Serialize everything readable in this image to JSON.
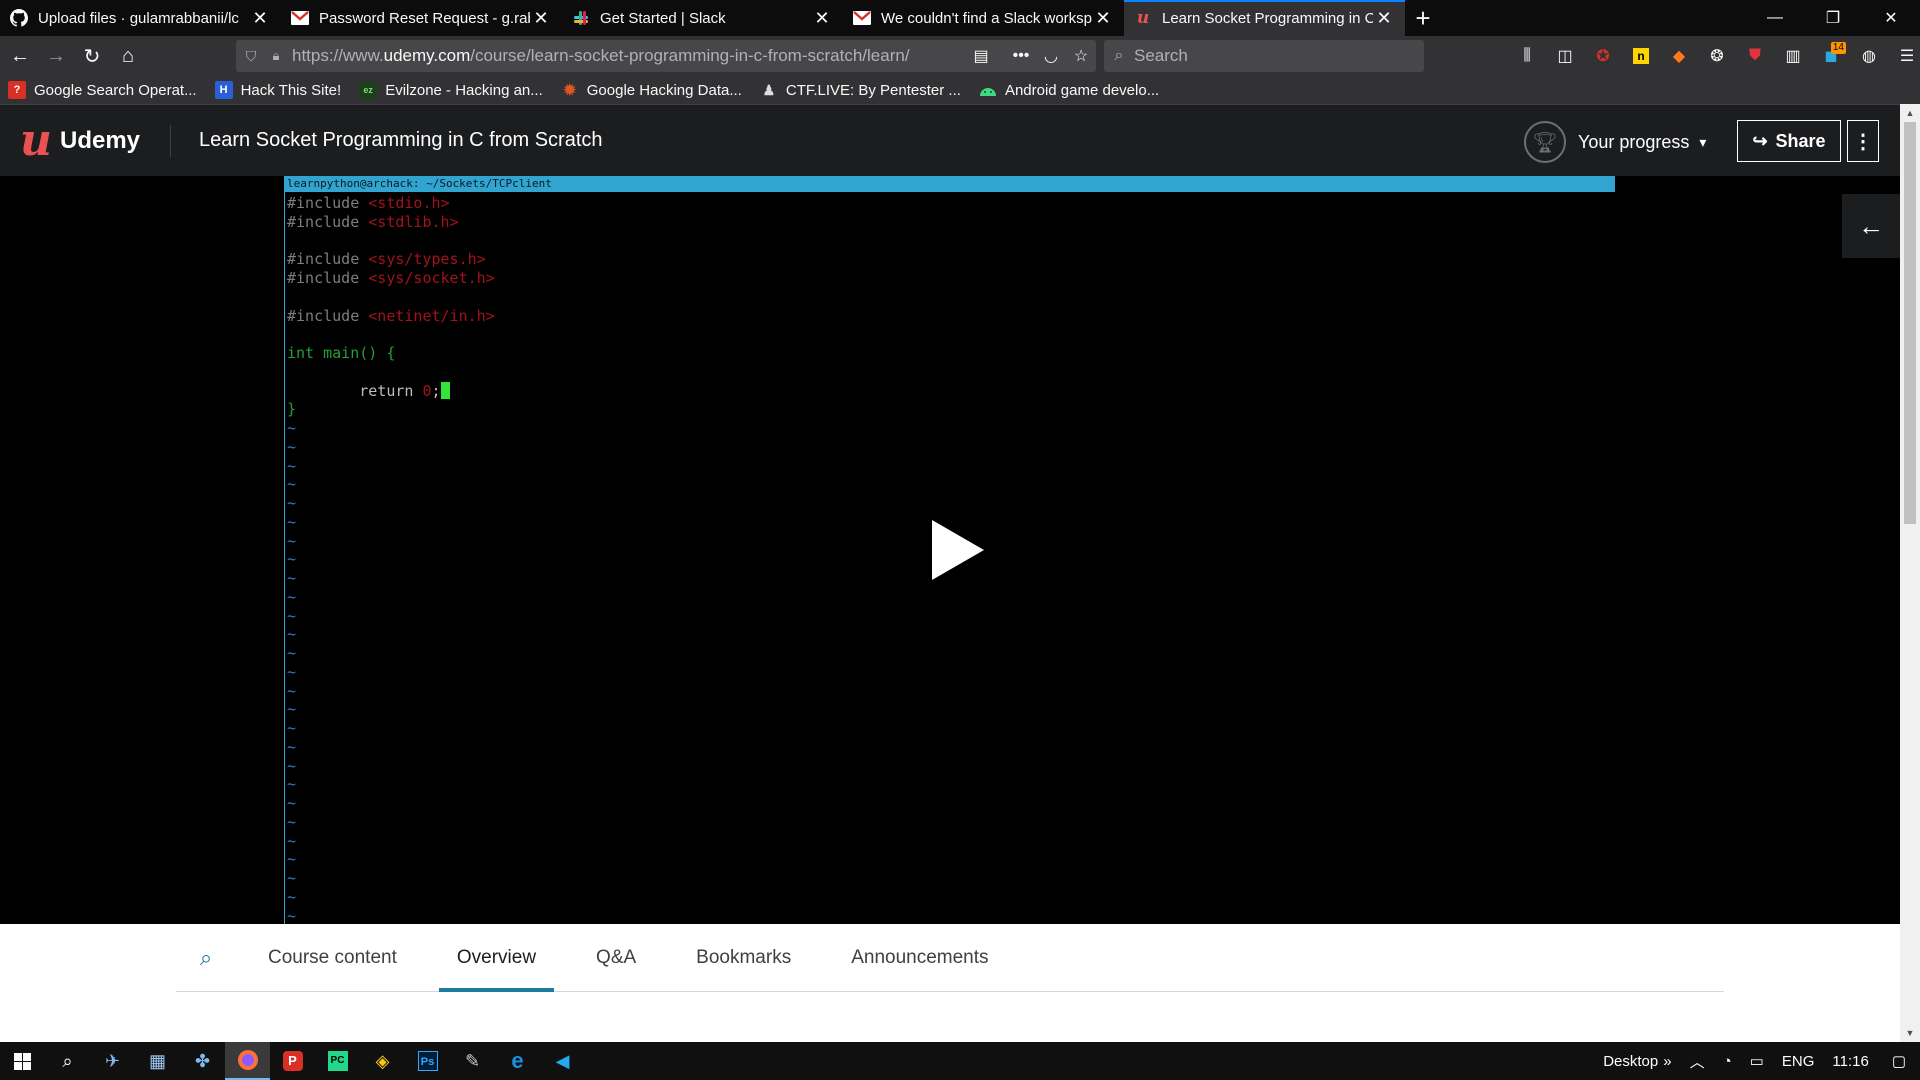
{
  "browser": {
    "tabs": [
      {
        "title": "Upload files · gulamrabbanii/lc",
        "icon": "github-icon",
        "active": false
      },
      {
        "title": "Password Reset Request - g.rab",
        "icon": "gmail-icon",
        "active": false
      },
      {
        "title": "Get Started | Slack",
        "icon": "slack-icon",
        "active": false
      },
      {
        "title": "We couldn't find a Slack worksp",
        "icon": "gmail-icon",
        "active": false
      },
      {
        "title": "Learn Socket Programming in C",
        "icon": "udemy-icon",
        "active": true
      }
    ],
    "url_prefix": "https://www.",
    "url_domain": "udemy.com",
    "url_path": "/course/learn-socket-programming-in-c-from-scratch/learn/",
    "search_placeholder": "Search",
    "toolbar_badge": "14",
    "bookmarks": [
      {
        "label": "Google Search Operat...",
        "icon": "bookmark-red-icon",
        "color": "#d93025"
      },
      {
        "label": "Hack This Site!",
        "icon": "hts-icon",
        "color": "#2a5fd6"
      },
      {
        "label": "Evilzone - Hacking an...",
        "icon": "evilzone-icon",
        "color": "#2f7d32"
      },
      {
        "label": "Google Hacking Data...",
        "icon": "exploitdb-icon",
        "color": "#e0581f"
      },
      {
        "label": "CTF.LIVE: By Pentester ...",
        "icon": "ctf-icon",
        "color": "#dddddd"
      },
      {
        "label": "Android game develo...",
        "icon": "android-icon",
        "color": "#3ddc84"
      }
    ]
  },
  "udemy": {
    "logo_text": "Udemy",
    "course_title": "Learn Socket Programming in C from Scratch",
    "progress_label": "Your progress",
    "share_label": "Share"
  },
  "terminal": {
    "title": "learnpython@archack: ~/Sockets/TCPclient",
    "include_kw": "#include",
    "includes": [
      "<stdio.h>",
      "<stdlib.h>",
      "<sys/types.h>",
      "<sys/socket.h>",
      "<netinet/in.h>"
    ],
    "main_type": "int",
    "main_sig": "main() {",
    "return_kw": "return",
    "return_val": "0",
    "return_end": ";",
    "close_brace": "}",
    "tilde": "~"
  },
  "course_tabs": [
    "Course content",
    "Overview",
    "Q&A",
    "Bookmarks",
    "Announcements"
  ],
  "active_course_tab": 1,
  "taskbar": {
    "desktop_label": "Desktop",
    "lang": "ENG",
    "time": "11:16"
  },
  "colors": {
    "udemy_red": "#ea5252",
    "firefox_accent": "#0a84ff",
    "tab_underline": "#1c7ba0"
  }
}
